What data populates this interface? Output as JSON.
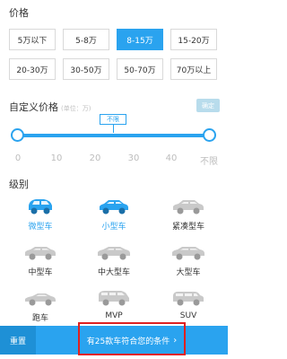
{
  "price": {
    "title": "价格",
    "options": [
      "5万以下",
      "5-8万",
      "8-15万",
      "15-20万",
      "20-30万",
      "30-50万",
      "50-70万",
      "70万以上"
    ],
    "selected": "8-15万"
  },
  "custom_price": {
    "title": "自定义价格",
    "unit_hint": "(单位：万)",
    "confirm_label": "确定",
    "bubble_label": "不限",
    "ticks": [
      "0",
      "10",
      "20",
      "30",
      "40",
      "不限"
    ]
  },
  "level": {
    "title": "级别",
    "cars": [
      {
        "label": "微型车",
        "icon": "mini-car-icon",
        "selected": true
      },
      {
        "label": "小型车",
        "icon": "small-car-icon",
        "selected": true
      },
      {
        "label": "紧凑型车",
        "icon": "compact-car-icon",
        "selected": false
      },
      {
        "label": "中型车",
        "icon": "midsize-car-icon",
        "selected": false
      },
      {
        "label": "中大型车",
        "icon": "large-midsize-car-icon",
        "selected": false
      },
      {
        "label": "大型车",
        "icon": "large-car-icon",
        "selected": false
      },
      {
        "label": "跑车",
        "icon": "sports-car-icon",
        "selected": false
      },
      {
        "label": "MVP",
        "icon": "mpv-icon",
        "selected": false
      },
      {
        "label": "SUV",
        "icon": "suv-icon",
        "selected": false
      }
    ]
  },
  "bottom": {
    "reset_label": "重置",
    "result_label": "有25款车符合您的条件",
    "chevron": "›"
  },
  "colors": {
    "accent": "#2aa3ef",
    "highlight": "#e02020"
  }
}
